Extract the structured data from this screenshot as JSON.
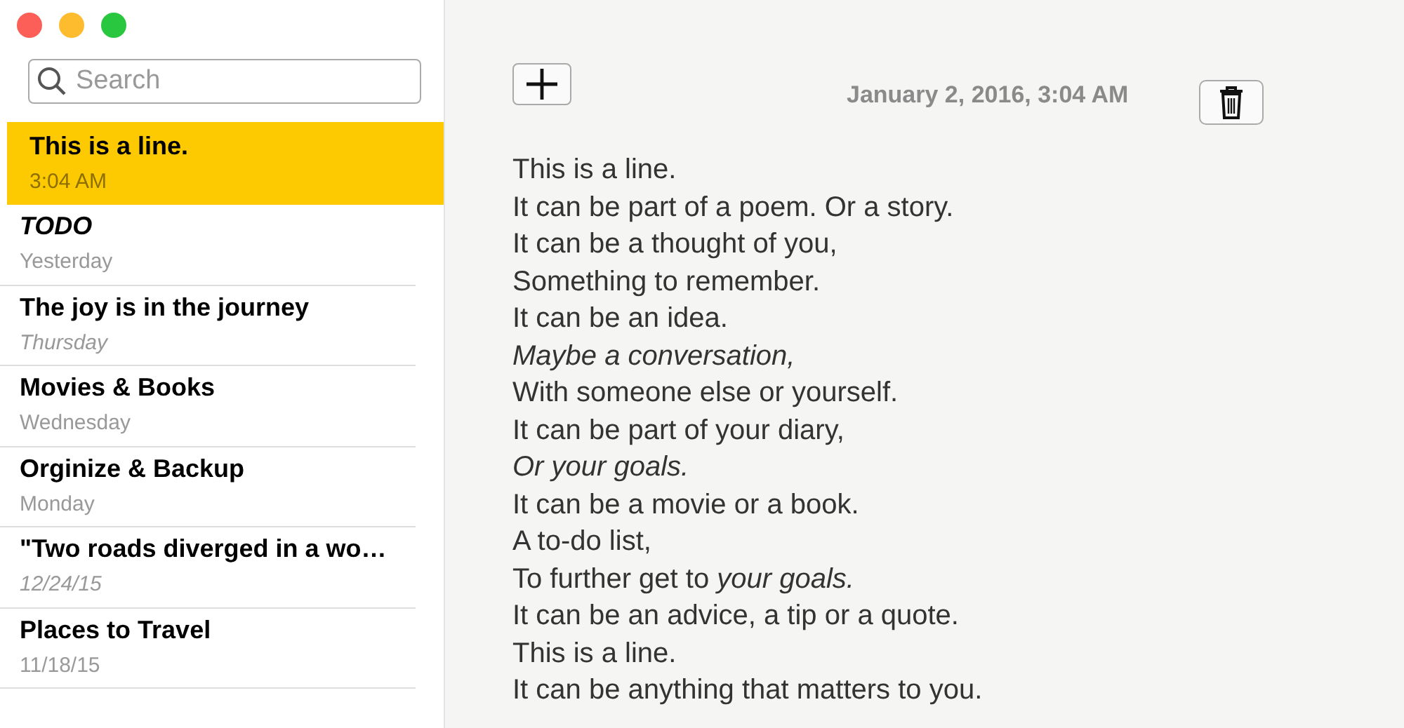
{
  "search": {
    "placeholder": "Search"
  },
  "notes": [
    {
      "title": "This is a line.",
      "date": "3:04 AM",
      "selected": true,
      "italic_title": false,
      "italic_date": false
    },
    {
      "title": "TODO",
      "date": "Yesterday",
      "selected": false,
      "italic_title": true,
      "italic_date": false
    },
    {
      "title": "The joy is in the journey",
      "date": "Thursday",
      "selected": false,
      "italic_title": false,
      "italic_date": true
    },
    {
      "title": "Movies & Books",
      "date": "Wednesday",
      "selected": false,
      "italic_title": false,
      "italic_date": false
    },
    {
      "title": "Orginize & Backup",
      "date": "Monday",
      "selected": false,
      "italic_title": false,
      "italic_date": false
    },
    {
      "title": "\"Two roads diverged in a wo…",
      "date": "12/24/15",
      "selected": false,
      "italic_title": false,
      "italic_date": true
    },
    {
      "title": "Places to Travel",
      "date": "11/18/15",
      "selected": false,
      "italic_title": false,
      "italic_date": false
    }
  ],
  "editor": {
    "date": "January 2, 2016, 3:04 AM",
    "lines": [
      {
        "text": "This is a line.",
        "italic": false
      },
      {
        "text": "It can be part of a poem. Or a story.",
        "italic": false
      },
      {
        "text": "It can be a thought of you,",
        "italic": false
      },
      {
        "text": "Something to remember.",
        "italic": false
      },
      {
        "text": "It can be an idea.",
        "italic": false
      },
      {
        "text": "Maybe a conversation,",
        "italic": true
      },
      {
        "text": "With someone else or yourself.",
        "italic": false
      },
      {
        "text": "It can be part of your diary,",
        "italic": false
      },
      {
        "text": "Or your goals.",
        "italic": true
      },
      {
        "text": "It can be a movie or a book.",
        "italic": false
      },
      {
        "text": "A to-do list,",
        "italic": false
      },
      {
        "text": "To further get to *your goals.*",
        "italic": false
      },
      {
        "text": "It can be an advice, a tip or a quote.",
        "italic": false
      },
      {
        "text": "This is a line.",
        "italic": false
      },
      {
        "text": "It can be anything that matters to you.",
        "italic": false
      }
    ]
  }
}
